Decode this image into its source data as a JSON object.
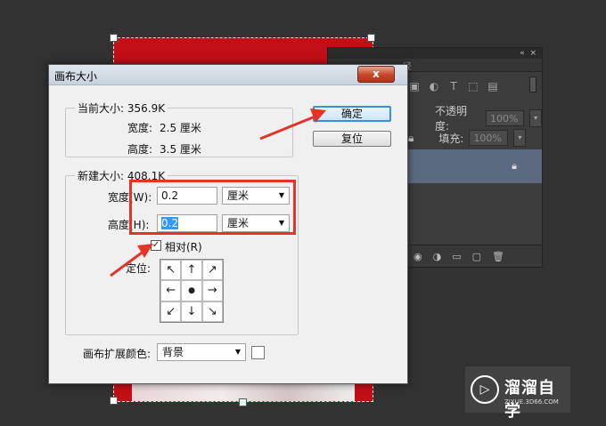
{
  "dialog": {
    "title": "画布大小",
    "close_label": "x",
    "current_size": {
      "legend": "当前大小: 356.9K",
      "width_label": "宽度:",
      "width_value": "2.5 厘米",
      "height_label": "高度:",
      "height_value": "3.5 厘米"
    },
    "new_size": {
      "legend": "新建大小: 408.1K",
      "width_label": "宽度(W):",
      "width_value": "0.2",
      "width_unit": "厘米",
      "height_label": "高度(H):",
      "height_value": "0.2",
      "height_unit": "厘米",
      "relative_label": "相对(R)",
      "relative_checked": true,
      "anchor_label": "定位:",
      "anchor_arrows": [
        "↖",
        "↑",
        "↗",
        "←",
        "●",
        "→",
        "↙",
        "↓",
        "↘"
      ]
    },
    "ok_label": "确定",
    "reset_label": "复位",
    "extension_color_label": "画布扩展颜色:",
    "extension_color_value": "背景"
  },
  "ps_panel": {
    "tab_label": "径",
    "opacity_label": "不透明度:",
    "opacity_value": "100%",
    "fill_label": "填充:",
    "fill_value": "100%"
  },
  "watermark": {
    "name": "溜溜自学",
    "url": "ZIXUE.3D66.COM"
  },
  "colors": {
    "annotation_red": "#e3342a",
    "canvas_red": "#c20f17",
    "selection_blue": "#3399ff"
  }
}
